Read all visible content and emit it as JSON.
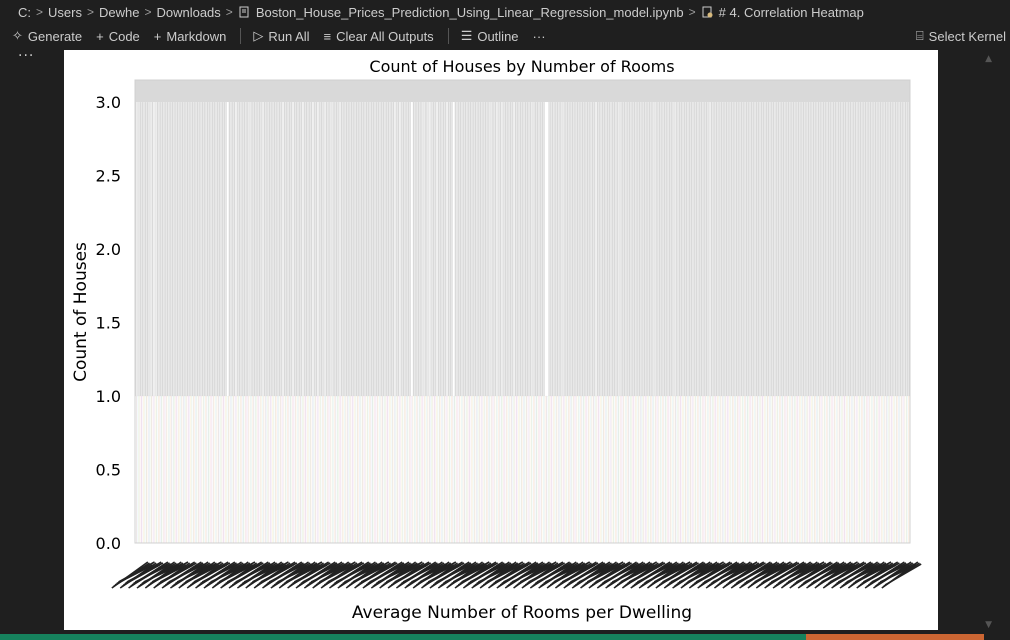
{
  "breadcrumb": {
    "items": [
      "C:",
      "Users",
      "Dewhe",
      "Downloads",
      "Boston_House_Prices_Prediction_Using_Linear_Regression_model.ipynb",
      "# 4. Correlation Heatmap"
    ]
  },
  "toolbar": {
    "generate_label": "Generate",
    "code_label": "Code",
    "markdown_label": "Markdown",
    "run_all_label": "Run All",
    "clear_outputs_label": "Clear All Outputs",
    "outline_label": "Outline",
    "more_label": "···",
    "select_kernel_label": "Select Kernel"
  },
  "cell": {
    "dots": "···"
  },
  "colors": {
    "background": "#1f1f1f",
    "status_green": "#16825d",
    "status_orange": "#cc6633",
    "bar_gray": "#d9d9d9"
  },
  "chart_data": {
    "type": "bar",
    "title": "Count of Houses by Number of Rooms",
    "xlabel": "Average Number of Rooms per Dwelling",
    "ylabel": "Count of Houses",
    "ylim": [
      0,
      3.15
    ],
    "yticks": [
      "0.0",
      "0.5",
      "1.0",
      "1.5",
      "2.0",
      "2.5",
      "3.0"
    ],
    "ytick_values": [
      0,
      0.5,
      1.0,
      1.5,
      2.0,
      2.5,
      3.0
    ],
    "grid": false,
    "note_categories": "446 unique RM values on x-axis; tick labels rendered illegibly overlapping",
    "values": [
      1,
      2,
      1,
      1,
      1,
      1,
      1,
      1,
      1,
      2,
      1,
      2,
      2,
      1,
      1,
      1,
      1,
      1,
      1,
      1,
      1,
      1,
      1,
      1,
      1,
      1,
      1,
      1,
      1,
      1,
      1,
      1,
      1,
      1,
      1,
      1,
      1,
      1,
      1,
      1,
      1,
      1,
      1,
      1,
      1,
      1,
      1,
      1,
      1,
      1,
      1,
      1,
      1,
      1,
      1,
      3,
      1,
      1,
      1,
      1,
      2,
      1,
      1,
      1,
      1,
      1,
      1,
      1,
      2,
      1,
      1,
      1,
      1,
      1,
      1,
      1,
      2,
      1,
      1,
      1,
      1,
      1,
      1,
      1,
      1,
      1,
      1,
      1,
      2,
      1,
      1,
      1,
      1,
      1,
      2,
      1,
      1,
      1,
      1,
      1,
      2,
      1,
      1,
      1,
      1,
      1,
      2,
      1,
      1,
      2,
      1,
      1,
      1,
      2,
      1,
      1,
      1,
      2,
      1,
      1,
      1,
      1,
      2,
      1,
      1,
      1,
      1,
      1,
      1,
      1,
      1,
      1,
      1,
      1,
      1,
      1,
      1,
      1,
      1,
      1,
      1,
      1,
      1,
      1,
      1,
      1,
      1,
      1,
      1,
      1,
      1,
      1,
      1,
      1,
      1,
      2,
      1,
      1,
      2,
      1,
      1,
      1,
      1,
      1,
      1,
      3,
      1,
      1,
      1,
      1,
      1,
      1,
      2,
      1,
      1,
      2,
      2,
      1,
      1,
      1,
      2,
      1,
      1,
      1,
      1,
      1,
      2,
      1,
      1,
      1,
      3,
      1,
      1,
      1,
      1,
      1,
      1,
      1,
      1,
      1,
      1,
      1,
      1,
      1,
      1,
      1,
      1,
      1,
      1,
      1,
      1,
      1,
      2,
      1,
      1,
      1,
      2,
      1,
      1,
      2,
      1,
      1,
      1,
      1,
      1,
      1,
      2,
      1,
      1,
      1,
      1,
      1,
      1,
      1,
      1,
      1,
      1,
      2,
      1,
      1,
      1,
      1,
      1,
      1,
      1,
      3,
      3,
      1,
      1,
      1,
      1,
      1,
      1,
      1,
      1,
      2,
      1,
      1,
      1,
      1,
      1,
      1,
      1,
      1,
      1,
      1,
      1,
      1,
      1,
      1,
      1,
      1,
      1,
      1,
      1,
      2,
      1,
      1,
      1,
      1,
      1,
      1,
      1,
      1,
      1,
      1,
      1,
      1,
      1,
      2,
      1,
      1,
      1,
      1,
      1,
      1,
      1,
      1,
      1,
      1,
      1,
      1,
      1,
      1,
      1,
      1,
      1,
      1,
      1,
      1,
      2,
      1,
      1,
      1,
      1,
      1,
      1,
      1,
      1,
      1,
      1,
      1,
      2,
      1,
      1,
      1,
      1,
      1,
      1,
      1,
      1,
      1,
      1,
      1,
      1,
      1,
      1,
      1,
      1,
      1,
      1,
      1,
      1,
      2,
      1,
      1,
      1,
      1,
      1,
      1,
      1,
      1,
      1,
      1,
      1,
      1,
      1,
      1,
      1,
      1,
      1,
      1,
      1,
      1,
      1,
      1,
      1,
      1,
      1,
      1,
      1,
      1,
      1,
      1,
      1,
      1,
      1,
      1,
      1,
      1,
      1,
      1,
      1,
      1,
      1,
      1,
      1,
      1,
      1,
      1,
      1,
      1,
      1,
      1,
      1,
      1,
      1,
      1,
      1,
      1,
      1,
      1,
      1,
      1,
      1,
      1,
      1,
      1,
      1,
      1,
      1,
      1,
      1,
      1,
      1,
      1,
      1,
      1,
      1,
      1,
      1,
      1,
      1,
      1,
      1,
      1,
      1,
      1,
      1,
      1,
      1,
      1,
      1,
      1,
      1,
      1,
      1,
      1,
      1,
      1,
      1,
      1,
      1,
      1,
      1,
      1,
      1,
      1,
      1,
      1,
      1,
      1,
      1,
      1,
      1,
      1,
      1,
      1,
      1,
      1,
      1,
      1,
      1
    ]
  }
}
